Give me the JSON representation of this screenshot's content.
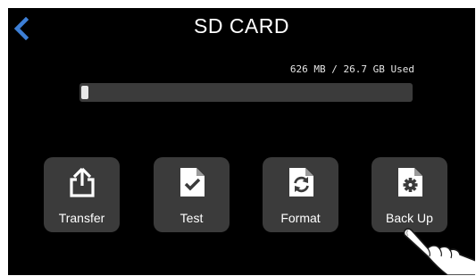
{
  "header": {
    "title": "SD CARD",
    "back_icon": "chevron-left-icon",
    "accent_color": "#3d7fd6"
  },
  "storage": {
    "usage_text": "626 MB / 26.7 GB Used",
    "used_mb": 626,
    "total_gb": 26.7,
    "used_fraction": 0.023
  },
  "tiles": [
    {
      "label": "Transfer",
      "icon": "share-upload-icon"
    },
    {
      "label": "Test",
      "icon": "document-check-icon"
    },
    {
      "label": "Format",
      "icon": "document-refresh-icon"
    },
    {
      "label": "Back Up",
      "icon": "document-gear-icon"
    }
  ]
}
